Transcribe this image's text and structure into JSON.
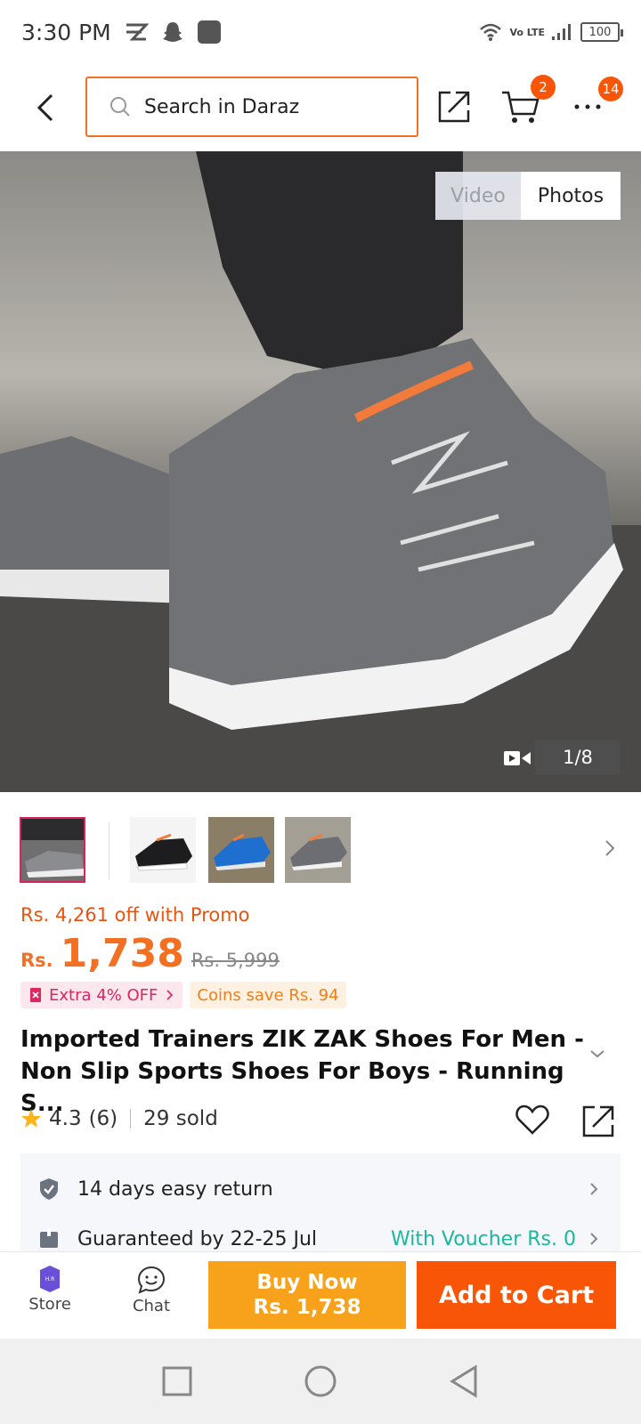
{
  "status_bar": {
    "time": "3:30 PM",
    "network": "Vo LTE",
    "battery": "100",
    "icons": [
      "tiktok-icon",
      "snapchat-icon",
      "app-square-icon",
      "wifi-icon",
      "signal-icon",
      "battery-icon"
    ]
  },
  "top_nav": {
    "search_placeholder": "Search in Daraz",
    "cart_badge": "2",
    "more_badge": "14"
  },
  "hero": {
    "toggle": {
      "video": "Video",
      "photos": "Photos",
      "selected": "photos"
    },
    "counter": "1/8"
  },
  "thumbnails": {
    "selected_index": 0,
    "items": [
      "grey-shoe-on-foot",
      "black-orange-shoe",
      "blue-shoe",
      "grey-orange-shoe"
    ]
  },
  "price": {
    "promo": "Rs. 4,261 off with Promo",
    "currency": "Rs.",
    "value": "1,738",
    "original": "Rs. 5,999",
    "tags": {
      "extra": "Extra 4% OFF",
      "coins": "Coins save Rs. 94"
    }
  },
  "product": {
    "title": "Imported Trainers ZIK ZAK Shoes For Men - Non Slip Sports Shoes For Boys - Running S...",
    "rating": "4.3",
    "reviews": "(6)",
    "sold": "29 sold"
  },
  "info": {
    "return": "14 days easy return",
    "delivery": "Guaranteed by 22-25 Jul",
    "voucher": "With Voucher Rs. 0"
  },
  "bottom_bar": {
    "store": "Store",
    "store_logo_text": "H.R",
    "chat": "Chat",
    "buy_now": "Buy Now",
    "buy_now_price": "Rs. 1,738",
    "add_to_cart": "Add to Cart"
  },
  "colors": {
    "brand_orange": "#f85606",
    "price_orange": "#f36f21",
    "buy_now": "#f8a21b",
    "promo_pink": "#e0245e",
    "voucher_teal": "#1bb79f"
  }
}
